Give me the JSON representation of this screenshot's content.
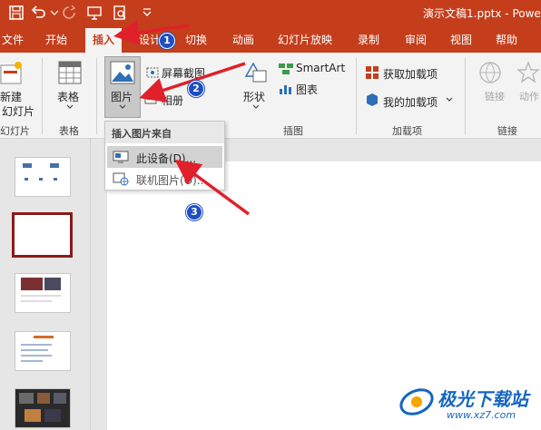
{
  "window": {
    "doc_title": "演示文稿1.pptx  -  Powe"
  },
  "quick_access": {
    "icons": [
      "save-icon",
      "undo-icon",
      "redo-icon",
      "present-icon",
      "print-preview-icon",
      "customize-icon"
    ]
  },
  "tabs": [
    "文件",
    "开始",
    "插入",
    "设计",
    "切换",
    "动画",
    "幻灯片放映",
    "录制",
    "审阅",
    "视图",
    "帮助"
  ],
  "active_tab": "插入",
  "ribbon": {
    "new_slide": [
      "新建",
      "幻灯片"
    ],
    "new_slide_group": "幻灯片",
    "table": "表格",
    "table_group": "表格",
    "picture": "图片",
    "screenshot": "屏幕截图",
    "album": "相册",
    "shapes": "形状",
    "smartart": "SmartArt",
    "chart": "图表",
    "illustrations_group": "插图",
    "get_addins": "获取加载项",
    "my_addins": "我的加载项",
    "addins_group": "加载项",
    "link": "链接",
    "action": "动作",
    "links_group": "链接"
  },
  "dropdown": {
    "header": "插入图片来自",
    "items": [
      "此设备(D)...",
      "联机图片(O)..."
    ]
  },
  "annotations": [
    "1",
    "2",
    "3"
  ],
  "watermark": {
    "name": "极光下载站",
    "url": "www.xz7.com"
  },
  "colors": {
    "accent": "#c43e1c",
    "annotation": "#1e4fbf",
    "arrow": "#e0202a"
  }
}
